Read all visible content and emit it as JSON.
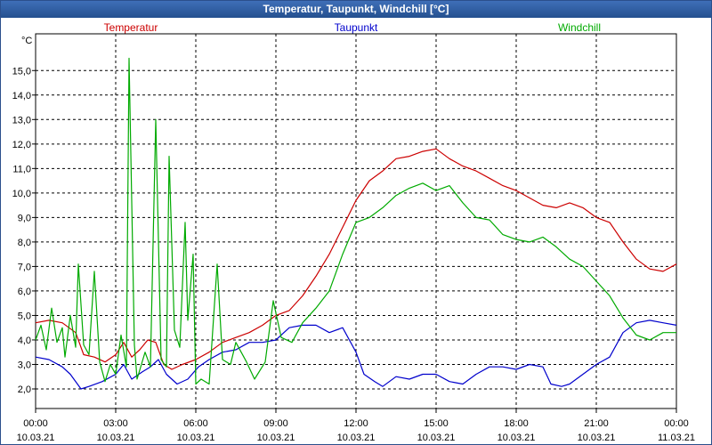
{
  "window": {
    "title": "Temperatur, Taupunkt, Windchill [°C]"
  },
  "chart_data": {
    "type": "line",
    "title": "Temperatur, Taupunkt, Windchill [°C]",
    "ylabel": "°C",
    "ylim": [
      1.2,
      16.5
    ],
    "xlim": [
      0,
      24
    ],
    "grid": true,
    "legend": "top",
    "yticks": [
      "2,0",
      "3,0",
      "4,0",
      "5,0",
      "6,0",
      "7,0",
      "8,0",
      "9,0",
      "10,0",
      "11,0",
      "12,0",
      "13,0",
      "14,0",
      "15,0"
    ],
    "xticks": [
      {
        "t": "00:00",
        "d": "10.03.21"
      },
      {
        "t": "03:00",
        "d": "10.03.21"
      },
      {
        "t": "06:00",
        "d": "10.03.21"
      },
      {
        "t": "09:00",
        "d": "10.03.21"
      },
      {
        "t": "12:00",
        "d": "10.03.21"
      },
      {
        "t": "15:00",
        "d": "10.03.21"
      },
      {
        "t": "18:00",
        "d": "10.03.21"
      },
      {
        "t": "21:00",
        "d": "10.03.21"
      },
      {
        "t": "00:00",
        "d": "11.03.21"
      }
    ],
    "series": [
      {
        "name": "Temperatur",
        "color": "#cc0000",
        "points": [
          [
            0,
            4.7
          ],
          [
            0.5,
            4.8
          ],
          [
            1,
            4.7
          ],
          [
            1.5,
            4.3
          ],
          [
            1.8,
            3.4
          ],
          [
            2.2,
            3.3
          ],
          [
            2.6,
            3.1
          ],
          [
            3,
            3.4
          ],
          [
            3.3,
            3.9
          ],
          [
            3.6,
            3.3
          ],
          [
            3.9,
            3.6
          ],
          [
            4.2,
            4.0
          ],
          [
            4.5,
            3.9
          ],
          [
            4.8,
            3.0
          ],
          [
            5.1,
            2.8
          ],
          [
            5.5,
            3.0
          ],
          [
            6,
            3.2
          ],
          [
            6.5,
            3.5
          ],
          [
            7,
            3.9
          ],
          [
            7.5,
            4.1
          ],
          [
            8,
            4.3
          ],
          [
            8.5,
            4.6
          ],
          [
            9,
            5.0
          ],
          [
            9.5,
            5.2
          ],
          [
            10,
            5.8
          ],
          [
            10.5,
            6.6
          ],
          [
            11,
            7.5
          ],
          [
            11.5,
            8.6
          ],
          [
            12,
            9.7
          ],
          [
            12.5,
            10.5
          ],
          [
            13,
            10.9
          ],
          [
            13.5,
            11.4
          ],
          [
            14,
            11.5
          ],
          [
            14.5,
            11.7
          ],
          [
            15,
            11.8
          ],
          [
            15.5,
            11.4
          ],
          [
            16,
            11.1
          ],
          [
            16.5,
            10.9
          ],
          [
            17,
            10.6
          ],
          [
            17.5,
            10.3
          ],
          [
            18,
            10.1
          ],
          [
            18.5,
            9.8
          ],
          [
            19,
            9.5
          ],
          [
            19.5,
            9.4
          ],
          [
            20,
            9.6
          ],
          [
            20.5,
            9.4
          ],
          [
            21,
            9.0
          ],
          [
            21.5,
            8.8
          ],
          [
            22,
            8.0
          ],
          [
            22.5,
            7.3
          ],
          [
            23,
            6.9
          ],
          [
            23.5,
            6.8
          ],
          [
            24,
            7.1
          ]
        ]
      },
      {
        "name": "Taupunkt",
        "color": "#0000cc",
        "points": [
          [
            0,
            3.3
          ],
          [
            0.5,
            3.2
          ],
          [
            1,
            2.9
          ],
          [
            1.3,
            2.6
          ],
          [
            1.7,
            2.0
          ],
          [
            2,
            2.1
          ],
          [
            2.5,
            2.3
          ],
          [
            3,
            2.6
          ],
          [
            3.3,
            3.0
          ],
          [
            3.6,
            2.4
          ],
          [
            4,
            2.7
          ],
          [
            4.3,
            2.9
          ],
          [
            4.6,
            3.2
          ],
          [
            4.9,
            2.6
          ],
          [
            5.3,
            2.2
          ],
          [
            5.7,
            2.4
          ],
          [
            6.1,
            2.9
          ],
          [
            6.5,
            3.2
          ],
          [
            7,
            3.5
          ],
          [
            7.5,
            3.6
          ],
          [
            8,
            3.9
          ],
          [
            8.5,
            3.9
          ],
          [
            9,
            4.0
          ],
          [
            9.5,
            4.5
          ],
          [
            10,
            4.6
          ],
          [
            10.5,
            4.6
          ],
          [
            11,
            4.3
          ],
          [
            11.5,
            4.5
          ],
          [
            12,
            3.5
          ],
          [
            12.3,
            2.6
          ],
          [
            12.7,
            2.3
          ],
          [
            13,
            2.1
          ],
          [
            13.5,
            2.5
          ],
          [
            14,
            2.4
          ],
          [
            14.5,
            2.6
          ],
          [
            15,
            2.6
          ],
          [
            15.5,
            2.3
          ],
          [
            16,
            2.2
          ],
          [
            16.5,
            2.6
          ],
          [
            17,
            2.9
          ],
          [
            17.5,
            2.9
          ],
          [
            18,
            2.8
          ],
          [
            18.5,
            3.0
          ],
          [
            19,
            2.9
          ],
          [
            19.3,
            2.2
          ],
          [
            19.7,
            2.1
          ],
          [
            20,
            2.2
          ],
          [
            20.5,
            2.6
          ],
          [
            21,
            3.0
          ],
          [
            21.5,
            3.3
          ],
          [
            22,
            4.3
          ],
          [
            22.5,
            4.7
          ],
          [
            23,
            4.8
          ],
          [
            23.5,
            4.7
          ],
          [
            24,
            4.6
          ]
        ]
      },
      {
        "name": "Windchill",
        "color": "#00aa00",
        "points": [
          [
            0,
            4.0
          ],
          [
            0.2,
            4.6
          ],
          [
            0.4,
            3.6
          ],
          [
            0.6,
            5.3
          ],
          [
            0.8,
            3.9
          ],
          [
            1,
            4.5
          ],
          [
            1.1,
            3.3
          ],
          [
            1.3,
            5.0
          ],
          [
            1.5,
            3.7
          ],
          [
            1.6,
            7.1
          ],
          [
            1.8,
            3.8
          ],
          [
            2,
            3.4
          ],
          [
            2.2,
            6.8
          ],
          [
            2.4,
            3.1
          ],
          [
            2.6,
            2.3
          ],
          [
            2.8,
            3.0
          ],
          [
            3,
            2.6
          ],
          [
            3.2,
            4.2
          ],
          [
            3.4,
            2.9
          ],
          [
            3.5,
            15.5
          ],
          [
            3.7,
            3.8
          ],
          [
            3.8,
            2.4
          ],
          [
            4.1,
            3.5
          ],
          [
            4.3,
            2.9
          ],
          [
            4.5,
            13.0
          ],
          [
            4.7,
            3.2
          ],
          [
            4.9,
            2.9
          ],
          [
            5,
            11.5
          ],
          [
            5.2,
            4.4
          ],
          [
            5.4,
            3.7
          ],
          [
            5.6,
            8.8
          ],
          [
            5.7,
            4.8
          ],
          [
            5.9,
            7.5
          ],
          [
            6,
            2.2
          ],
          [
            6.2,
            2.4
          ],
          [
            6.5,
            2.2
          ],
          [
            6.8,
            7.1
          ],
          [
            7,
            3.2
          ],
          [
            7.3,
            3.0
          ],
          [
            7.5,
            3.9
          ],
          [
            7.9,
            3.1
          ],
          [
            8.2,
            2.4
          ],
          [
            8.6,
            3.1
          ],
          [
            8.9,
            5.6
          ],
          [
            9.2,
            4.1
          ],
          [
            9.6,
            3.9
          ],
          [
            10,
            4.7
          ],
          [
            10.5,
            5.3
          ],
          [
            11,
            6.0
          ],
          [
            11.5,
            7.5
          ],
          [
            12,
            8.8
          ],
          [
            12.5,
            9.0
          ],
          [
            13,
            9.4
          ],
          [
            13.5,
            9.9
          ],
          [
            14,
            10.2
          ],
          [
            14.5,
            10.4
          ],
          [
            15,
            10.1
          ],
          [
            15.5,
            10.3
          ],
          [
            16,
            9.6
          ],
          [
            16.5,
            9.0
          ],
          [
            17,
            8.9
          ],
          [
            17.5,
            8.3
          ],
          [
            18,
            8.1
          ],
          [
            18.5,
            8.0
          ],
          [
            19,
            8.2
          ],
          [
            19.5,
            7.8
          ],
          [
            20,
            7.3
          ],
          [
            20.5,
            7.0
          ],
          [
            21,
            6.4
          ],
          [
            21.5,
            5.8
          ],
          [
            22,
            4.9
          ],
          [
            22.5,
            4.2
          ],
          [
            23,
            4.0
          ],
          [
            23.5,
            4.3
          ],
          [
            24,
            4.3
          ]
        ]
      }
    ]
  }
}
